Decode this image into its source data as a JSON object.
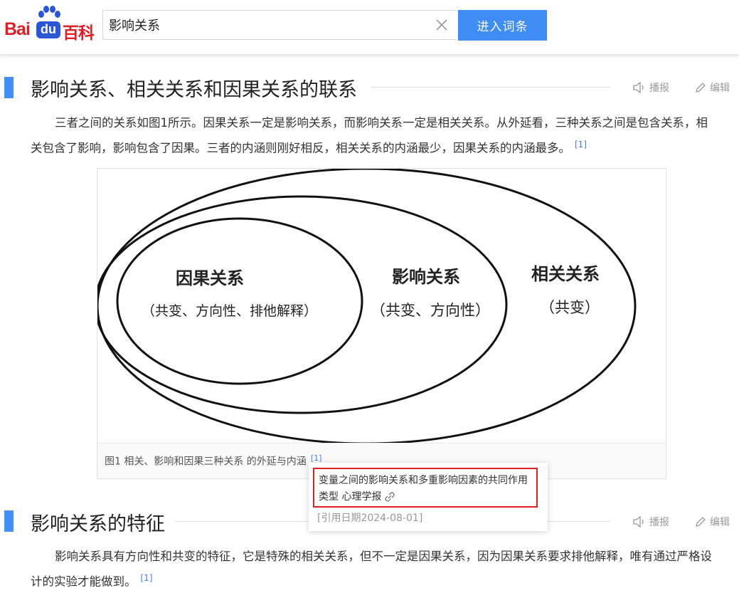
{
  "header": {
    "logo": {
      "bai": "Bai",
      "du": "du",
      "baike": "百科"
    },
    "search_value": "影响关系",
    "search_button": "进入词条"
  },
  "sections": [
    {
      "title": "影响关系、相关关系和因果关系的联系",
      "tools": {
        "broadcast": "播报",
        "edit": "编辑"
      },
      "paragraph": "三者之间的关系如图1所示。因果关系一定是影响关系，而影响关系一定是相关关系。从外延看，三种关系之间是包含关系，相关包含了影响，影响包含了因果。三者的内涵则刚好相反，相关关系的内涵最少，因果关系的内涵最多。",
      "ref": "[1]"
    },
    {
      "title": "影响关系的特征",
      "tools": {
        "broadcast": "播报",
        "edit": "编辑"
      },
      "paragraph": "影响关系具有方向性和共变的特征，它是特殊的相关关系，但不一定是因果关系，因为因果关系要求排他解释，唯有通过严格设计的实验才能做到。",
      "ref": "[1]"
    }
  ],
  "figure": {
    "caption": "图1 相关、影响和因果三种关系 的外延与内涵",
    "caption_ref": "[1]",
    "ellipses": [
      {
        "name": "因果关系",
        "sub": "（共变、方向性、排他解释）"
      },
      {
        "name": "影响关系",
        "sub": "（共变、方向性）"
      },
      {
        "name": "相关关系",
        "sub": "（共变）"
      }
    ]
  },
  "tooltip": {
    "citation": "变量之间的影响关系和多重影响因素的共同作用类型 心理学报",
    "date": "[引用日期2024-08-01]"
  },
  "icons": {
    "clear": "close-icon",
    "broadcast": "speaker-icon",
    "edit": "pencil-icon",
    "link": "link-icon"
  },
  "colors": {
    "brand_red": "#de1f26",
    "brand_blue": "#2a55d4",
    "accent": "#4290f6",
    "button": "#3f8cf5",
    "highlight": "#e02020"
  }
}
